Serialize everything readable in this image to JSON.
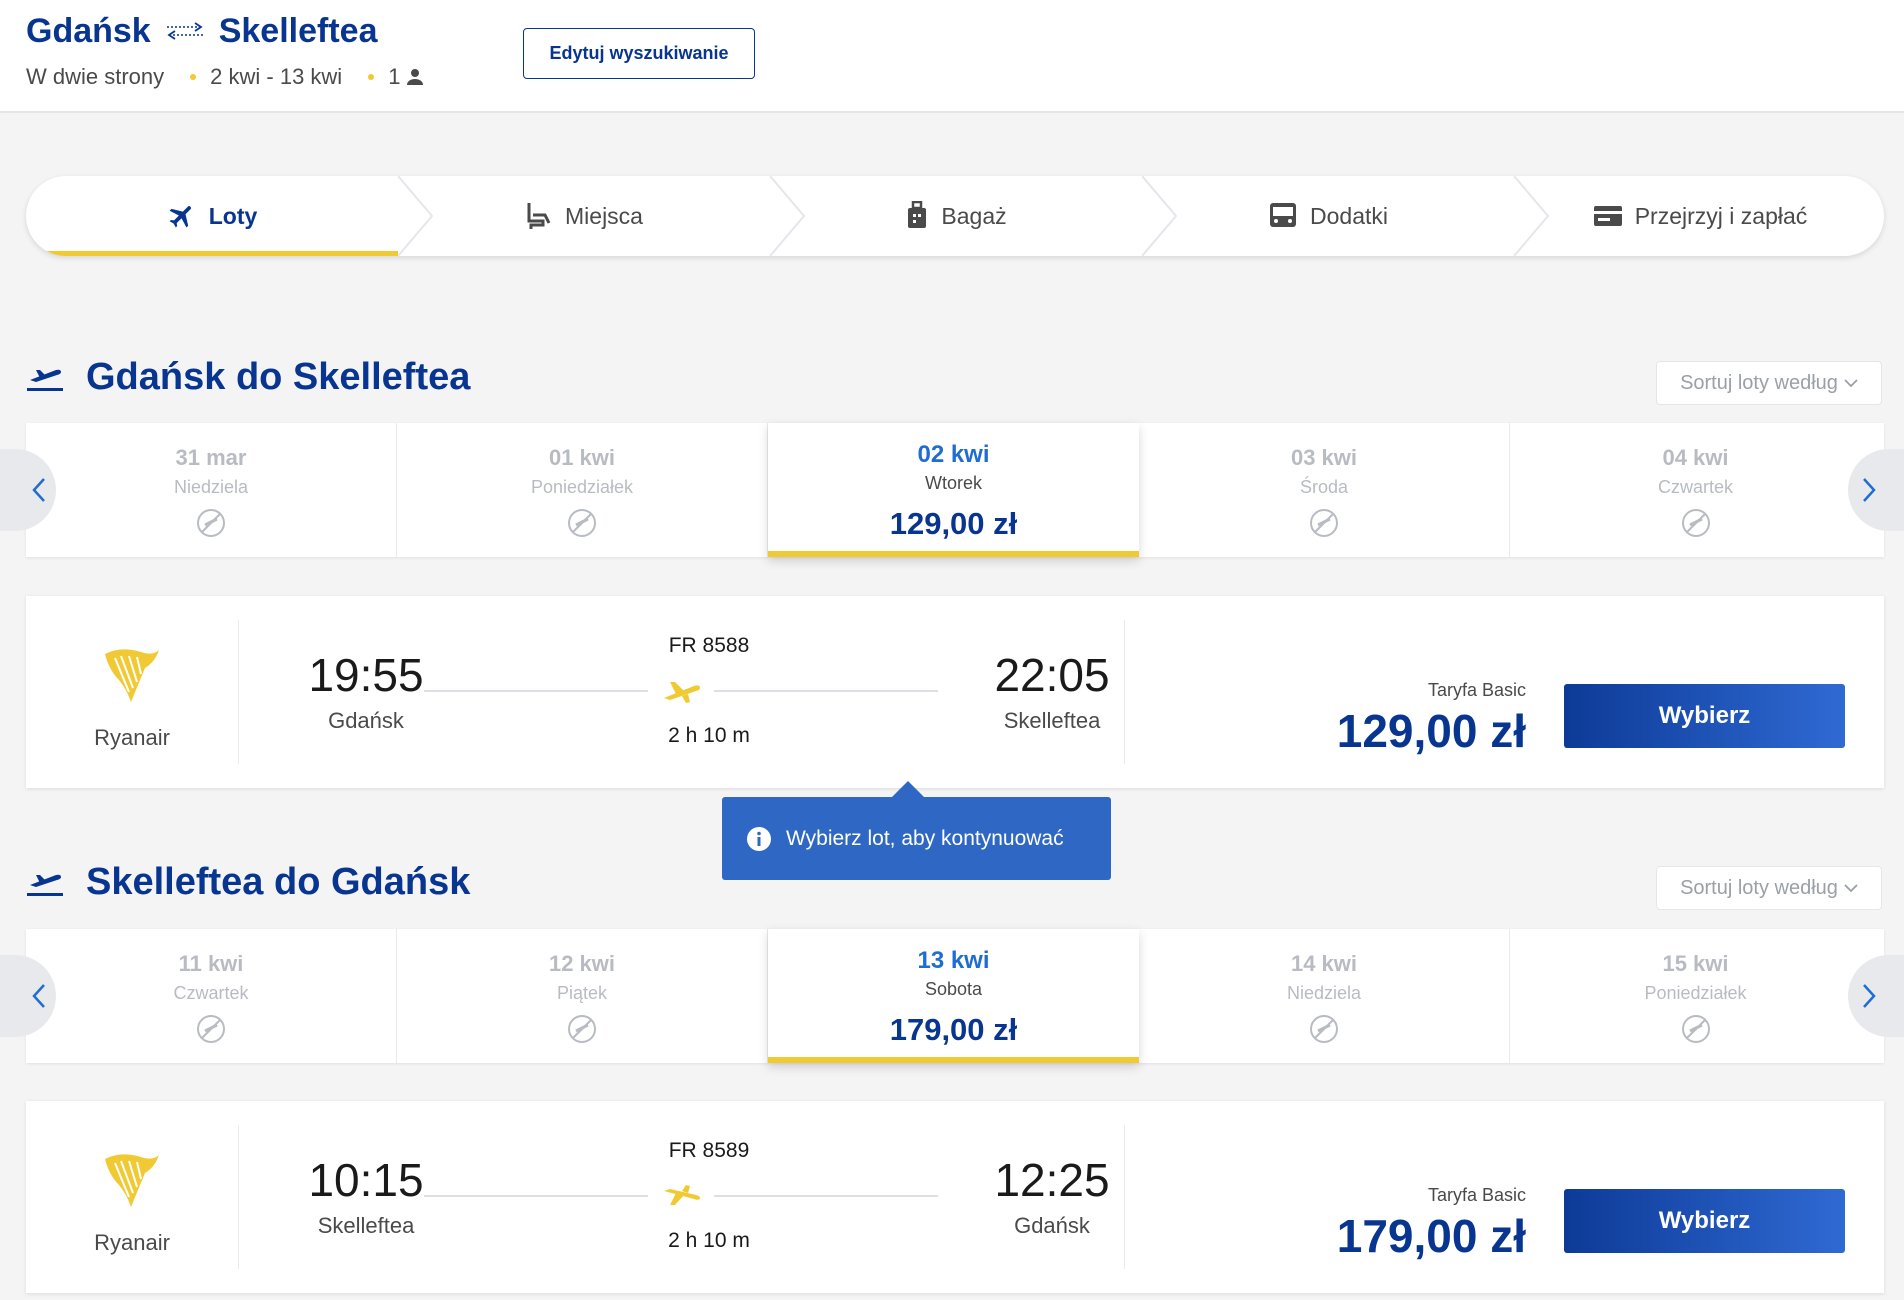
{
  "header": {
    "from": "Gdańsk",
    "to": "Skelleftea",
    "trip_type": "W dwie strony",
    "dates": "2 kwi - 13 kwi",
    "passengers": "1",
    "edit_label": "Edytuj wyszukiwanie"
  },
  "steps": [
    {
      "label": "Loty",
      "icon": "plane-icon"
    },
    {
      "label": "Miejsca",
      "icon": "seat-icon"
    },
    {
      "label": "Bagaż",
      "icon": "luggage-icon"
    },
    {
      "label": "Dodatki",
      "icon": "bus-icon"
    },
    {
      "label": "Przejrzyj i zapłać",
      "icon": "card-icon"
    }
  ],
  "sort_label": "Sortuj loty według",
  "outbound": {
    "title": "Gdańsk do Skelleftea",
    "dates": [
      {
        "date": "31 mar",
        "weekday": "Niedziela"
      },
      {
        "date": "01 kwi",
        "weekday": "Poniedziałek"
      },
      {
        "date": "02 kwi",
        "weekday": "Wtorek",
        "price": "129,00 zł"
      },
      {
        "date": "03 kwi",
        "weekday": "Środa"
      },
      {
        "date": "04 kwi",
        "weekday": "Czwartek"
      }
    ],
    "flight": {
      "airline": "Ryanair",
      "dep_time": "19:55",
      "dep_city": "Gdańsk",
      "flight_no": "FR 8588",
      "duration": "2 h 10 m",
      "arr_time": "22:05",
      "arr_city": "Skelleftea",
      "fare_label": "Taryfa Basic",
      "price": "129,00 zł",
      "select_label": "Wybierz"
    }
  },
  "tooltip": "Wybierz lot, aby kontynuować",
  "inbound": {
    "title": "Skelleftea do Gdańsk",
    "dates": [
      {
        "date": "11 kwi",
        "weekday": "Czwartek"
      },
      {
        "date": "12 kwi",
        "weekday": "Piątek"
      },
      {
        "date": "13 kwi",
        "weekday": "Sobota",
        "price": "179,00 zł"
      },
      {
        "date": "14 kwi",
        "weekday": "Niedziela"
      },
      {
        "date": "15 kwi",
        "weekday": "Poniedziałek"
      }
    ],
    "flight": {
      "airline": "Ryanair",
      "dep_time": "10:15",
      "dep_city": "Skelleftea",
      "flight_no": "FR 8589",
      "duration": "2 h 10 m",
      "arr_time": "12:25",
      "arr_city": "Gdańsk",
      "fare_label": "Taryfa Basic",
      "price": "179,00 zł",
      "select_label": "Wybierz"
    }
  },
  "colors": {
    "brand_blue": "#073590",
    "accent_yellow": "#f1c933",
    "link_blue": "#1f6dd1",
    "tooltip_blue": "#2f68c4"
  }
}
